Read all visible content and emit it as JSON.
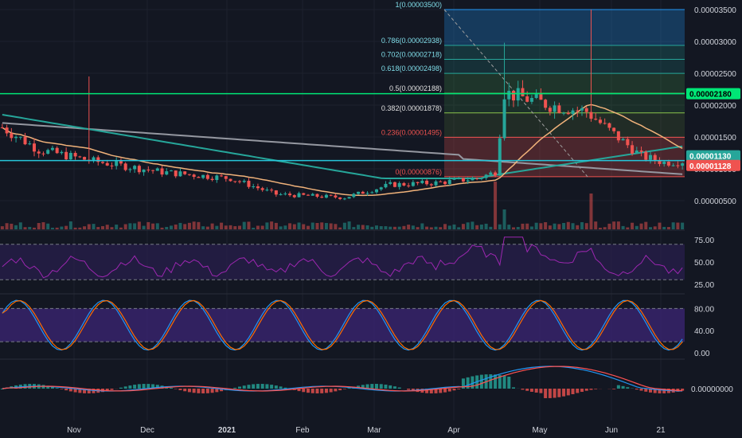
{
  "chart_data": {
    "type": "candlestick",
    "price_axis": {
      "ticks": [
        "0.00003500",
        "0.00003000",
        "0.00002500",
        "0.00002000",
        "0.00001500",
        "0.00001000",
        "0.00000500"
      ],
      "values": [
        3.5e-05,
        3e-05,
        2.5e-05,
        2e-05,
        1.5e-05,
        1e-05,
        5e-06
      ],
      "range": [
        5e-07,
        3.65e-05
      ]
    },
    "time_axis": {
      "labels": [
        "Nov",
        "Dec",
        "2021",
        "Feb",
        "Mar",
        "Apr",
        "May",
        "Jun",
        "21"
      ]
    },
    "fib_levels": [
      {
        "label": "1(0.00003500)",
        "value": 3.5e-05
      },
      {
        "label": "0.786(0.00002938)",
        "value": 2.938e-05
      },
      {
        "label": "0.702(0.00002718)",
        "value": 2.718e-05
      },
      {
        "label": "0.618(0.00002498)",
        "value": 2.498e-05
      },
      {
        "label": "0.5(0.00002188)",
        "value": 2.188e-05
      },
      {
        "label": "0.382(0.00001878)",
        "value": 1.878e-05
      },
      {
        "label": "0.236(0.00001495)",
        "value": 1.495e-05
      },
      {
        "label": "0(0.00000876)",
        "value": 8.76e-06
      }
    ],
    "price_badges": [
      {
        "label": "0.00002180",
        "value": 2.18e-05,
        "color": "#00e676",
        "text_color": "#000000"
      },
      {
        "label": "0.00001130",
        "value": 1.13e-05,
        "color": "#26a69a",
        "text_color": "#ffffff"
      },
      {
        "label": "0.00001128",
        "value": 1.128e-05,
        "color": "#ef5350",
        "text_color": "#ffffff"
      }
    ],
    "horizontal_lines": [
      {
        "value": 2.18e-05,
        "color": "#00e676"
      },
      {
        "value": 1.13e-05,
        "color": "#26c6da"
      }
    ],
    "rsi": {
      "ticks": [
        "75.00",
        "50.00",
        "25.00"
      ],
      "values": [
        75,
        50,
        25
      ],
      "upper": 70,
      "lower": 30
    },
    "stoch": {
      "ticks": [
        "80.00",
        "40.00",
        "0.00"
      ],
      "values": [
        80,
        40,
        0
      ],
      "upper": 80,
      "lower": 20
    },
    "macd": {
      "ticks": [
        "0.00000000"
      ]
    },
    "colors": {
      "up": "#26a69a",
      "down": "#ef5350",
      "bg": "#131722",
      "grid": "#1e222d",
      "axis_text": "#d1d4dc",
      "rsi_line": "#9c27b0",
      "band": "#2a1f4f"
    }
  }
}
